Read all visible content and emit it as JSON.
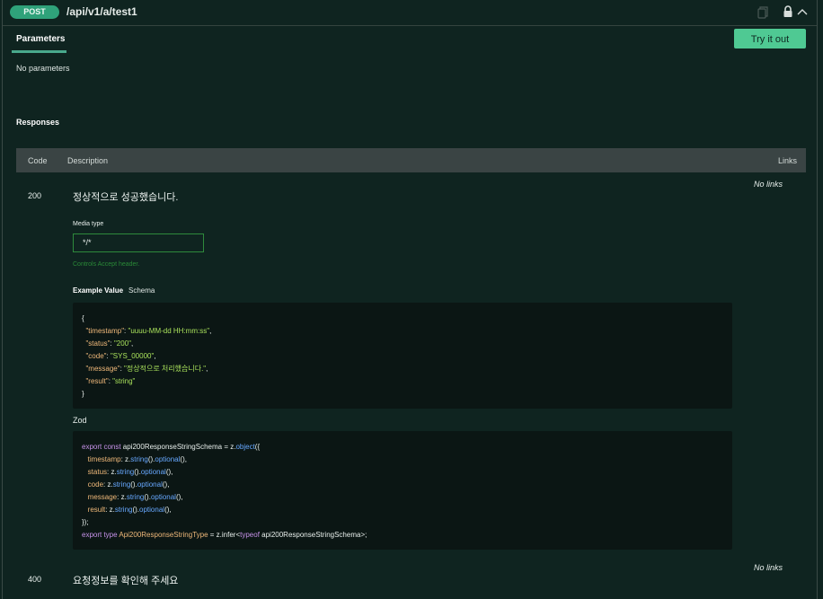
{
  "header": {
    "method": "POST",
    "path": "/api/v1/a/test1",
    "icons": [
      "copy-icon",
      "lock-icon",
      "chevron-up-icon"
    ]
  },
  "parameters": {
    "tab_label": "Parameters",
    "try_it_out": "Try it out",
    "empty_text": "No parameters"
  },
  "responses": {
    "title": "Responses",
    "columns": {
      "code": "Code",
      "description": "Description",
      "links": "Links"
    },
    "items": [
      {
        "code": "200",
        "description": "정상적으로 성공했습니다.",
        "links": "No links",
        "media_type_label": "Media type",
        "media_type_value": "*/*",
        "controls_accept": "Controls Accept header.",
        "tabs": {
          "example": "Example Value",
          "schema": "Schema"
        },
        "example_lines": [
          "{",
          "  \"timestamp\": \"uuuu-MM-dd HH:mm:ss\",",
          "  \"status\": \"200\",",
          "  \"code\": \"SYS_00000\",",
          "  \"message\": \"정상적으로 처리했습니다.\",",
          "  \"result\": \"string\"",
          "}"
        ],
        "zod_label": "Zod",
        "zod_lines": [
          "export const api200ResponseStringSchema = z.object({",
          "  timestamp: z.string().optional(),",
          "  status: z.string().optional(),",
          "  code: z.string().optional(),",
          "  message: z.string().optional(),",
          "  result: z.string().optional(),",
          "});",
          "export type Api200ResponseStringType = z.infer<typeof api200ResponseStringSchema>;"
        ]
      },
      {
        "code": "400",
        "description": "요청정보를 확인해 주세요",
        "links": "No links"
      }
    ]
  },
  "colors": {
    "background": "#0f2420",
    "method_badge": "#2fa27a",
    "try_button": "#4fc993",
    "accent_underline": "#49a98c",
    "table_header": "#3a4444",
    "code_bg": "#0b1614",
    "json_string": "#a9e15b",
    "json_key": "#f0b97a",
    "keyword": "#c792ea",
    "function": "#67a8ff"
  }
}
